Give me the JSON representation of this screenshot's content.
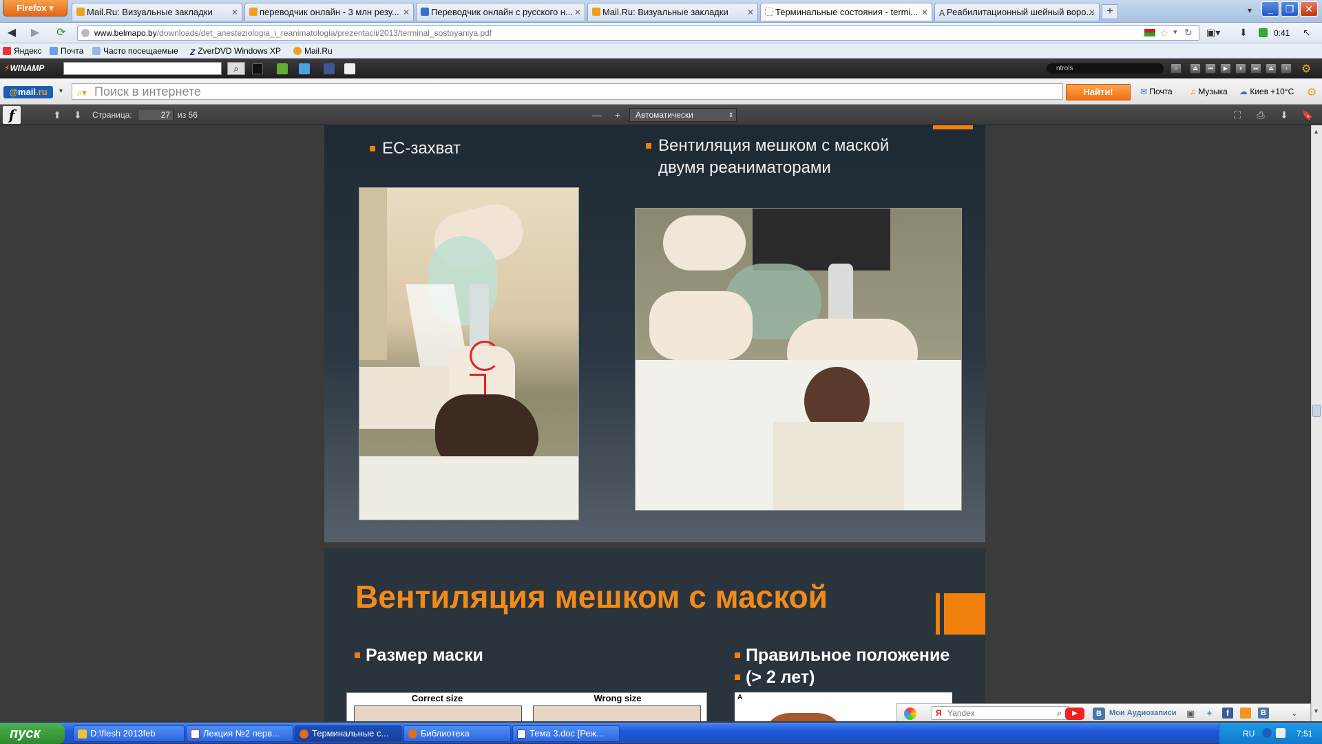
{
  "browser": {
    "menu_label": "Firefox",
    "tabs": [
      {
        "label": "Mail.Ru: Визуальные закладки"
      },
      {
        "label": "переводчик онлайн - 3 млн резу..."
      },
      {
        "label": "Переводчик онлайн с русского н..."
      },
      {
        "label": "Mail.Ru: Визуальные закладки"
      },
      {
        "label": "Терминальные состояния - termi..."
      },
      {
        "label": "Реабилитационный шейный воро..."
      }
    ],
    "new_tab": "+",
    "url_host": "www.belmapo.by",
    "url_path": "/downloads/det_anesteziologia_i_reanimatologia/prezentacii/2013/terminal_sostoyaniya.pdf",
    "clock": "0:41"
  },
  "bookmarks": [
    {
      "label": "Яндекс"
    },
    {
      "label": "Почта"
    },
    {
      "label": "Часто посещаемые"
    },
    {
      "label": "ZverDVD Windows XP"
    },
    {
      "label": "Mail.Ru"
    }
  ],
  "winamp": {
    "logo": "WINAMP",
    "track": "ntrols"
  },
  "mailru": {
    "logo_prefix": "@",
    "logo_main": "mail",
    "logo_suffix": ".ru",
    "search_placeholder": "Поиск в интернете",
    "find_button": "Найти!",
    "links": {
      "mail": "Почта",
      "music": "Музыка",
      "weather": "Киев +10°C"
    }
  },
  "pdf": {
    "page_label": "Страница:",
    "page_current": "27",
    "page_total": "из 56",
    "zoom_minus": "—",
    "zoom_plus": "+",
    "zoom_value": "Автоматически"
  },
  "slide1": {
    "bullet_left": "EC-захват",
    "bullet_right": "Вентиляция мешком с маской двумя реаниматорами"
  },
  "slide2": {
    "title": "Вентиляция мешком с маской",
    "bullet_left": "Размер маски",
    "bullet_right_line1": "Правильное положение",
    "bullet_right_line2": "(> 2 лет)",
    "table_headers": [
      "Correct size",
      "Wrong size"
    ],
    "figure_label": "A"
  },
  "yandex_bar": {
    "search_text": "Yandex",
    "audio_label": "Мои Аудиозаписи"
  },
  "taskbar": {
    "start": "пуск",
    "tasks": [
      {
        "label": "D:\\flesh 2013feb"
      },
      {
        "label": "Лекция №2 перв..."
      },
      {
        "label": "Терминальные с..."
      },
      {
        "label": "Библиотека"
      },
      {
        "label": "Тема 3.doc [Реж..."
      }
    ],
    "lang": "RU",
    "time": "7:51"
  },
  "colors": {
    "accent_orange": "#f07f0c",
    "title_orange": "#f28a1a",
    "slide_bg": "#2a343d"
  }
}
